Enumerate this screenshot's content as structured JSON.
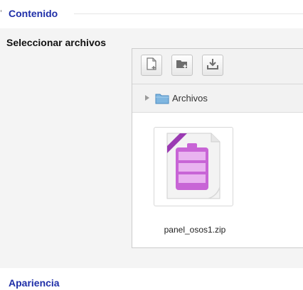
{
  "sections": {
    "contenido": {
      "title": "Contenido"
    },
    "apariencia": {
      "title": "Apariencia"
    }
  },
  "field": {
    "label": "Seleccionar archivos"
  },
  "filepicker": {
    "toolbar": {
      "add_icon": "add-file-icon",
      "folder_icon": "create-folder-icon",
      "download_icon": "download-icon"
    },
    "path": {
      "label": "Archivos",
      "icon": "folder-icon"
    },
    "files": [
      {
        "name": "panel_osos1.zip",
        "icon": "zip-archive-icon"
      }
    ]
  },
  "colors": {
    "section_title": "#1f2fa8",
    "zip_icon": "#b04fc4"
  }
}
